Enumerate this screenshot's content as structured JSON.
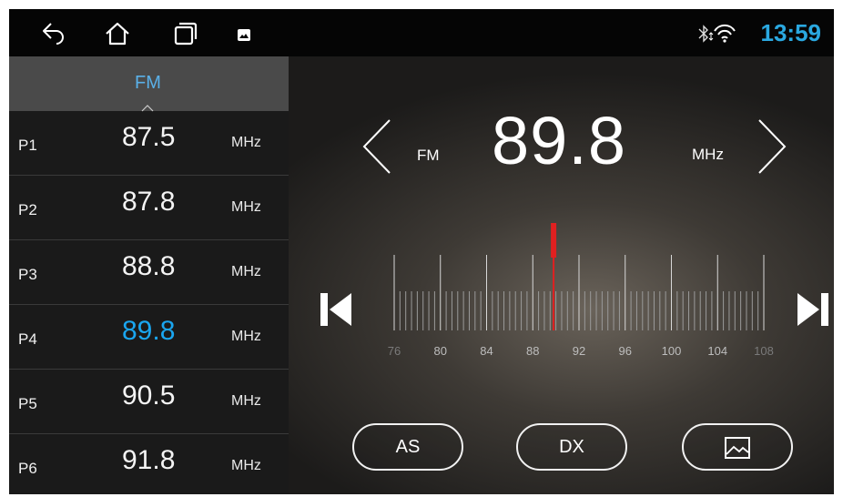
{
  "status_bar": {
    "time": "13:59",
    "icons": [
      "back-icon",
      "home-icon",
      "recent-apps-icon",
      "gallery-icon",
      "bluetooth-icon",
      "wifi-icon"
    ]
  },
  "band_tab": {
    "label": "FM"
  },
  "presets": [
    {
      "id": "P1",
      "freq": "87.5",
      "unit": "MHz",
      "active": false
    },
    {
      "id": "P2",
      "freq": "87.8",
      "unit": "MHz",
      "active": false
    },
    {
      "id": "P3",
      "freq": "88.8",
      "unit": "MHz",
      "active": false
    },
    {
      "id": "P4",
      "freq": "89.8",
      "unit": "MHz",
      "active": true
    },
    {
      "id": "P5",
      "freq": "90.5",
      "unit": "MHz",
      "active": false
    },
    {
      "id": "P6",
      "freq": "91.8",
      "unit": "MHz",
      "active": false
    }
  ],
  "tuner": {
    "band": "FM",
    "frequency": "89.8",
    "unit": "MHz",
    "frequency_value": 89.8,
    "scale_min": 76,
    "scale_max": 108,
    "scale_labels": [
      "76",
      "80",
      "84",
      "88",
      "92",
      "96",
      "100",
      "104",
      "108"
    ],
    "needle_color": "#e02020"
  },
  "buttons": {
    "as": "AS",
    "dx": "DX",
    "background_icon": "image-icon"
  },
  "colors": {
    "accent": "#1aa6f0",
    "clock": "#2aa8e0"
  }
}
